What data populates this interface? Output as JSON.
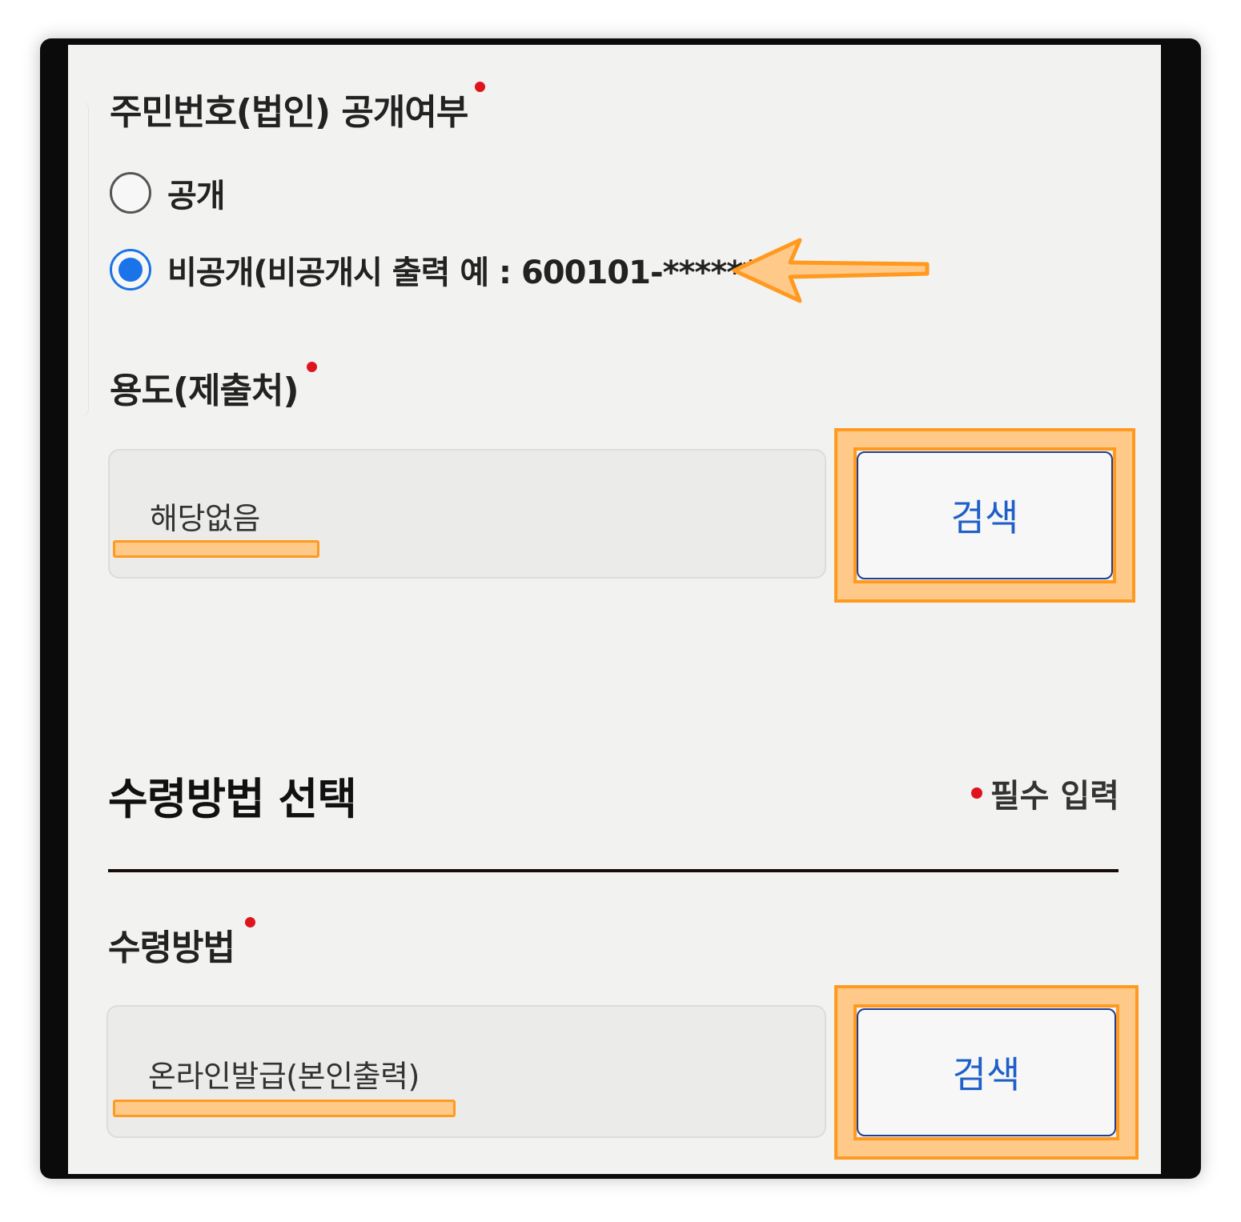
{
  "disclosure": {
    "title": "주민번호(법인) 공개여부",
    "options": [
      {
        "label": "공개",
        "selected": false
      },
      {
        "label": "비공개(비공개시 출력 예 : 600101-*******)",
        "selected": true
      }
    ]
  },
  "purpose": {
    "title": "용도(제출처)",
    "value": "해당없음",
    "search_label": "검색"
  },
  "receipt_section": {
    "heading": "수령방법 선택",
    "required_note": "필수 입력"
  },
  "receipt": {
    "title": "수령방법",
    "value": "온라인발급(본인출력)",
    "search_label": "검색"
  },
  "colors": {
    "required_dot": "#e0141e",
    "radio_selected": "#1a73e8",
    "button_text": "#1f5fc8",
    "highlight_fill": "#ffc98a",
    "highlight_stroke": "#ff9a1f"
  },
  "icons": {
    "arrow": "arrow-left-icon"
  }
}
